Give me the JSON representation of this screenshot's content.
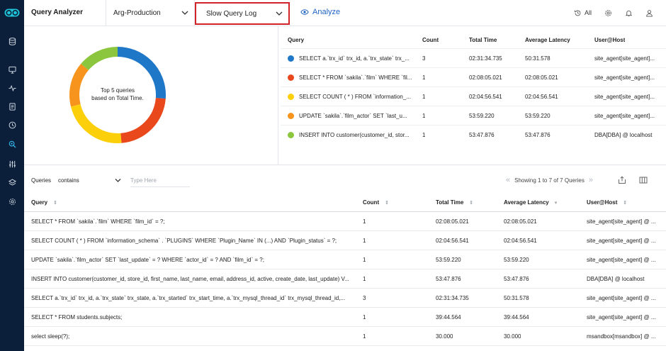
{
  "header": {
    "app_title": "Query Analyzer",
    "server_select": "Arg-Production",
    "log_select": "Slow Query Log",
    "analyze_label": "Analyze",
    "history_label": "All"
  },
  "sidebar": {
    "items": [
      "database-icon",
      "monitor-icon",
      "activity-icon",
      "report-icon",
      "clock-icon",
      "query-analyzer-icon",
      "sliders-icon",
      "layers-icon",
      "settings-icon"
    ]
  },
  "donut": {
    "label_line1": "Top 5 queries",
    "label_line2": "based on Total Time.",
    "segments": [
      {
        "color": "#1f77c8",
        "fraction": 0.262
      },
      {
        "color": "#e8481c",
        "fraction": 0.225
      },
      {
        "color": "#fbcf0a",
        "fraction": 0.224
      },
      {
        "color": "#f7941d",
        "fraction": 0.151
      },
      {
        "color": "#8cc63e",
        "fraction": 0.138
      }
    ]
  },
  "top_table": {
    "headers": [
      "Query",
      "Count",
      "Total Time",
      "Average Latency",
      "User@Host"
    ],
    "rows": [
      {
        "color": "#1f77c8",
        "query": "SELECT a.`trx_id` trx_id, a.`trx_state` trx_...",
        "count": "3",
        "total": "02:31:34.735",
        "avg": "50:31.578",
        "user": "site_agent[site_agent]..."
      },
      {
        "color": "#e8481c",
        "query": "SELECT * FROM `sakila`.`film` WHERE `fil...",
        "count": "1",
        "total": "02:08:05.021",
        "avg": "02:08:05.021",
        "user": "site_agent[site_agent]..."
      },
      {
        "color": "#fbcf0a",
        "query": "SELECT COUNT ( * ) FROM `information_...",
        "count": "1",
        "total": "02:04:56.541",
        "avg": "02:04:56.541",
        "user": "site_agent[site_agent]..."
      },
      {
        "color": "#f7941d",
        "query": "UPDATE `sakila`.`film_actor` SET `last_u...",
        "count": "1",
        "total": "53:59.220",
        "avg": "53:59.220",
        "user": "site_agent[site_agent]..."
      },
      {
        "color": "#8cc63e",
        "query": "INSERT INTO customer(customer_id, stor...",
        "count": "1",
        "total": "53:47.876",
        "avg": "53:47.876",
        "user": "DBA[DBA] @ localhost"
      }
    ]
  },
  "filter": {
    "field_label": "Queries",
    "operator": "contains",
    "placeholder": "Type Here",
    "showing": "Showing 1 to 7 of 7 Queries"
  },
  "bottom_table": {
    "headers": [
      "Query",
      "Count",
      "Total Time",
      "Average Latency",
      "User@Host"
    ],
    "rows": [
      {
        "query": "SELECT * FROM `sakila`.`film` WHERE `film_id` = ?;",
        "count": "1",
        "total": "02:08:05.021",
        "avg": "02:08:05.021",
        "user": "site_agent[site_agent] @ ..."
      },
      {
        "query": "SELECT COUNT ( * ) FROM `information_schema` . `PLUGINS` WHERE `Plugin_Name` IN (...) AND `Plugin_status` = ?;",
        "count": "1",
        "total": "02:04:56.541",
        "avg": "02:04:56.541",
        "user": "site_agent[site_agent] @ ..."
      },
      {
        "query": "UPDATE `sakila`.`film_actor` SET `last_update` = ? WHERE `actor_id` = ? AND `film_id` = ?;",
        "count": "1",
        "total": "53:59.220",
        "avg": "53:59.220",
        "user": "site_agent[site_agent] @ ..."
      },
      {
        "query": "INSERT INTO customer(customer_id, store_id, first_name, last_name, email, address_id, active, create_date, last_update) V...",
        "count": "1",
        "total": "53:47.876",
        "avg": "53:47.876",
        "user": "DBA[DBA] @ localhost"
      },
      {
        "query": "SELECT a.`trx_id` trx_id, a.`trx_state` trx_state, a.`trx_started` trx_start_time, a.`trx_mysql_thread_id` trx_mysql_thread_id,...",
        "count": "3",
        "total": "02:31:34.735",
        "avg": "50:31.578",
        "user": "site_agent[site_agent] @ ..."
      },
      {
        "query": "SELECT * FROM students.subjects;",
        "count": "1",
        "total": "39:44.564",
        "avg": "39:44.564",
        "user": "site_agent[site_agent] @ ..."
      },
      {
        "query": "select sleep(?);",
        "count": "1",
        "total": "30.000",
        "avg": "30.000",
        "user": "msandbox[msandbox] @ ..."
      }
    ]
  }
}
